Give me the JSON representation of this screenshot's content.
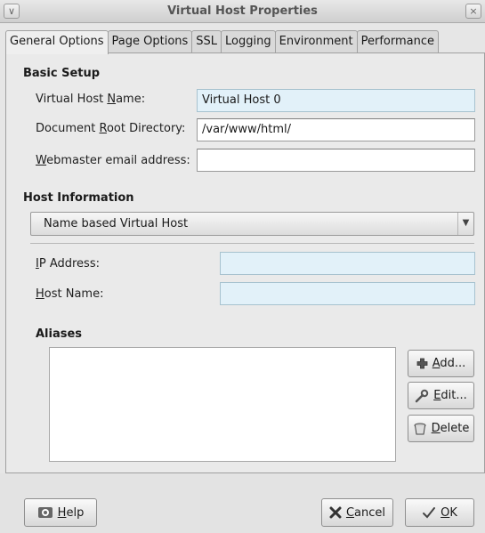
{
  "window": {
    "title": "Virtual Host Properties",
    "menu_glyph": "∨",
    "close_glyph": "×"
  },
  "tabs": [
    {
      "label": "General Options",
      "active": true
    },
    {
      "label": "Page Options",
      "active": false
    },
    {
      "label": "SSL",
      "active": false
    },
    {
      "label": "Logging",
      "active": false
    },
    {
      "label": "Environment",
      "active": false
    },
    {
      "label": "Performance",
      "active": false
    }
  ],
  "basic_setup": {
    "heading": "Basic Setup",
    "vhost_name": {
      "label_pre": "Virtual Host ",
      "label_key": "N",
      "label_post": "ame:",
      "value": "Virtual Host 0"
    },
    "doc_root": {
      "label_pre": "Document ",
      "label_key": "R",
      "label_post": "oot Directory:",
      "value": "/var/www/html/"
    },
    "webmaster": {
      "label_pre": "",
      "label_key": "W",
      "label_post": "ebmaster email address:",
      "value": ""
    }
  },
  "host_info": {
    "heading": "Host Information",
    "type_selected": "Name based Virtual Host",
    "ip": {
      "label_pre": "",
      "label_key": "I",
      "label_post": "P Address:",
      "value": ""
    },
    "host_name": {
      "label_pre": "",
      "label_key": "H",
      "label_post": "ost Name:",
      "value": ""
    }
  },
  "aliases": {
    "heading": "Aliases",
    "add_pre": "",
    "add_key": "A",
    "add_post": "dd...",
    "edit_pre": "",
    "edit_key": "E",
    "edit_post": "dit...",
    "delete_pre": "",
    "delete_key": "D",
    "delete_post": "elete"
  },
  "footer": {
    "help_pre": "",
    "help_key": "H",
    "help_post": "elp",
    "cancel_pre": "",
    "cancel_key": "C",
    "cancel_post": "ancel",
    "ok_pre": "",
    "ok_key": "O",
    "ok_post": "K"
  },
  "colors": {
    "field_highlight": "#e2f1f9",
    "panel_bg": "#eaeaea"
  }
}
